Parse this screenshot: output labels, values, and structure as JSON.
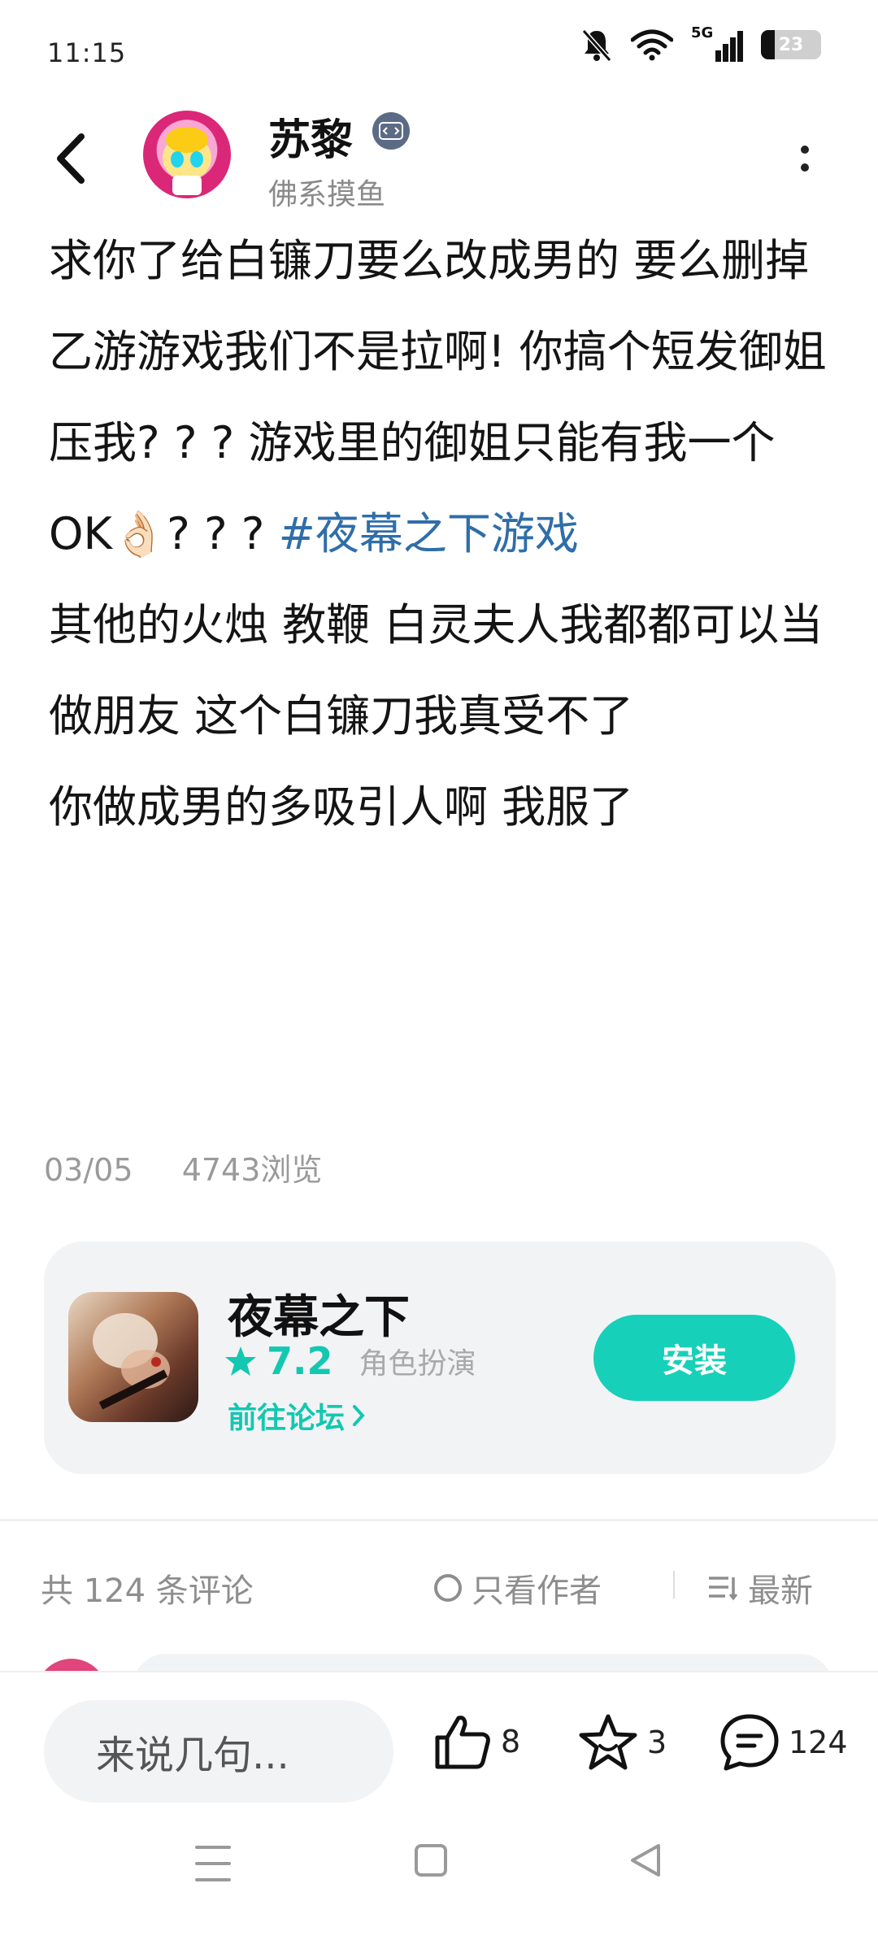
{
  "status_bar": {
    "time": "11:15",
    "network": "5G",
    "battery": "23",
    "battery_fraction": 0.23,
    "icons": [
      "mute-bell-icon",
      "wifi-icon",
      "signal-icon",
      "battery-icon"
    ]
  },
  "header": {
    "author_name": "苏黎",
    "author_bio": "佛系摸鱼",
    "icons": [
      "back-icon",
      "developer-badge-icon",
      "more-icon"
    ]
  },
  "post": {
    "line1": "求你了给白镰刀要么改成男的 要么删掉",
    "line2_text": "乙游游戏我们不是拉啊! 你搞个短发御姐压我? ? ? 游戏里的御姐只能有我一个OK👌🏻? ? ? ",
    "hashtag": "#夜幕之下游戏",
    "line3": "其他的火烛 教鞭 白灵夫人我都都可以当做朋友 这个白镰刀我真受不了",
    "line4": "你做成男的多吸引人啊 我服了",
    "date": "03/05",
    "views": "4743浏览"
  },
  "game_card": {
    "title": "夜幕之下",
    "rating": "7.2",
    "genre": "角色扮演",
    "forum_link": "前往论坛",
    "install_label": "安装",
    "accent_color": "#17d0b9"
  },
  "comments_header": {
    "count_label": "共 124 条评论",
    "author_only_label": "只看作者",
    "sort_label": "最新"
  },
  "bottom_bar": {
    "input_placeholder": "来说几句...",
    "likes": "8",
    "favorites": "3",
    "comments": "124"
  },
  "nav_bar": {
    "icons": [
      "menu-icon",
      "home-icon",
      "back-triangle-icon"
    ]
  }
}
